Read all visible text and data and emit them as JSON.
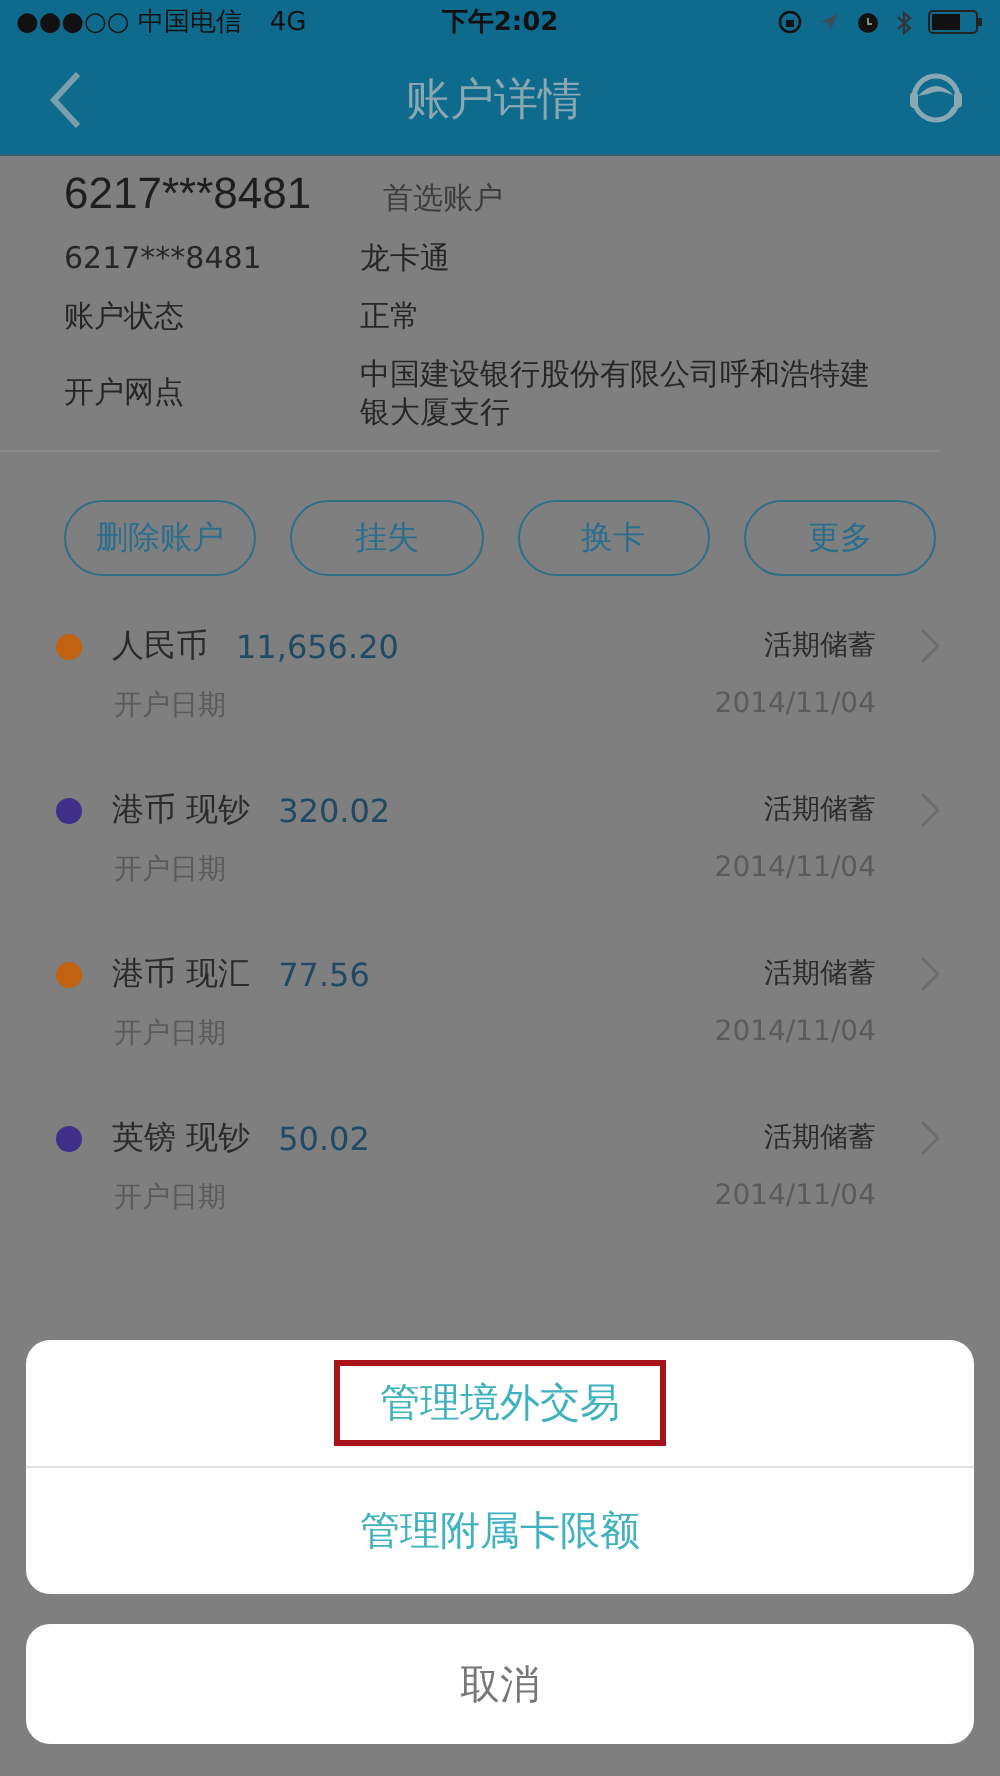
{
  "status_bar": {
    "carrier": "●●●○○ 中国电信",
    "network": "4G",
    "time": "下午2:02"
  },
  "nav": {
    "title": "账户详情"
  },
  "account": {
    "number": "6217***8481",
    "tag": "首选账户",
    "details": [
      {
        "label": "6217***8481",
        "value": "龙卡通"
      },
      {
        "label": "账户状态",
        "value": "正常"
      },
      {
        "label": "开户网点",
        "value": "中国建设银行股份有限公司呼和浩特建银大厦支行"
      }
    ]
  },
  "actions": [
    "删除账户",
    "挂失",
    "换卡",
    "更多"
  ],
  "sub_accounts": [
    {
      "currency": "人民币",
      "balance": "11,656.20",
      "type": "活期储蓄",
      "date_label": "开户日期",
      "date": "2014/11/04",
      "color": "#c0620f"
    },
    {
      "currency": "港币 现钞",
      "balance": "320.02",
      "type": "活期储蓄",
      "date_label": "开户日期",
      "date": "2014/11/04",
      "color": "#3f2f8a"
    },
    {
      "currency": "港币 现汇",
      "balance": "77.56",
      "type": "活期储蓄",
      "date_label": "开户日期",
      "date": "2014/11/04",
      "color": "#c0620f"
    },
    {
      "currency": "英镑 现钞",
      "balance": "50.02",
      "type": "活期储蓄",
      "date_label": "开户日期",
      "date": "2014/11/04",
      "color": "#3f2f8a"
    }
  ],
  "action_sheet": {
    "options": [
      {
        "label": "管理境外交易",
        "highlighted": true
      },
      {
        "label": "管理附属卡限额",
        "highlighted": false
      }
    ],
    "cancel": "取消"
  }
}
